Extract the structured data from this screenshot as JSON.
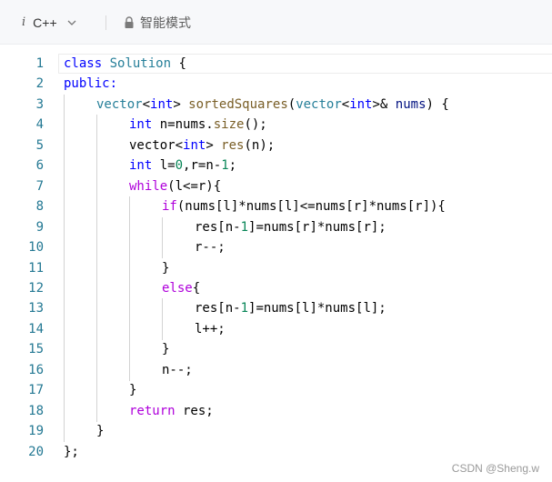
{
  "toolbar": {
    "info_glyph": "i",
    "language": "C++",
    "language_icon": "chevron-down-icon",
    "mode_icon": "lock-icon",
    "mode_label": "智能模式"
  },
  "editor": {
    "lines": [
      {
        "n": "1",
        "indent": 0,
        "tokens": [
          [
            "kw",
            "class"
          ],
          [
            "",
            " "
          ],
          [
            "typ",
            "Solution"
          ],
          [
            "",
            " {"
          ]
        ]
      },
      {
        "n": "2",
        "indent": 0,
        "tokens": [
          [
            "kw",
            "public:"
          ]
        ]
      },
      {
        "n": "3",
        "indent": 1,
        "tokens": [
          [
            "typ",
            "vector"
          ],
          [
            "",
            "<"
          ],
          [
            "kw",
            "int"
          ],
          [
            "",
            "> "
          ],
          [
            "fn",
            "sortedSquares"
          ],
          [
            "",
            "("
          ],
          [
            "typ",
            "vector"
          ],
          [
            "",
            "<"
          ],
          [
            "kw",
            "int"
          ],
          [
            "",
            "&gt;& "
          ],
          [
            "var",
            "nums"
          ],
          [
            "",
            ") {"
          ]
        ]
      },
      {
        "n": "4",
        "indent": 2,
        "tokens": [
          [
            "kw",
            "int"
          ],
          [
            "",
            ""
          ],
          [
            "",
            " n=nums."
          ],
          [
            "fn",
            "size"
          ],
          [
            "",
            "();"
          ]
        ]
      },
      {
        "n": "5",
        "indent": 2,
        "tokens": [
          [
            "",
            "vector<"
          ],
          [
            "kw",
            "int"
          ],
          [
            "",
            "> "
          ],
          [
            "fn",
            "res"
          ],
          [
            "",
            "(n);"
          ]
        ]
      },
      {
        "n": "6",
        "indent": 2,
        "tokens": [
          [
            "kw",
            "int"
          ],
          [
            "",
            " l="
          ],
          [
            "num",
            "0"
          ],
          [
            "",
            ",r=n-"
          ],
          [
            "num",
            "1"
          ],
          [
            "",
            ";"
          ]
        ]
      },
      {
        "n": "7",
        "indent": 2,
        "tokens": [
          [
            "ctl",
            "while"
          ],
          [
            "",
            "(l<=r){"
          ]
        ]
      },
      {
        "n": "8",
        "indent": 3,
        "tokens": [
          [
            "ctl",
            "if"
          ],
          [
            "",
            "(nums[l]*nums[l]<=nums[r]*nums[r]){"
          ]
        ]
      },
      {
        "n": "9",
        "indent": 4,
        "tokens": [
          [
            "",
            "res[n-"
          ],
          [
            "num",
            "1"
          ],
          [
            "",
            "]=nums[r]*nums[r];"
          ]
        ]
      },
      {
        "n": "10",
        "indent": 4,
        "tokens": [
          [
            "",
            "r--;"
          ]
        ]
      },
      {
        "n": "11",
        "indent": 3,
        "tokens": [
          [
            "",
            "}"
          ]
        ]
      },
      {
        "n": "12",
        "indent": 3,
        "tokens": [
          [
            "ctl",
            "else"
          ],
          [
            "",
            "{"
          ]
        ]
      },
      {
        "n": "13",
        "indent": 4,
        "tokens": [
          [
            "",
            "res[n-"
          ],
          [
            "num",
            "1"
          ],
          [
            "",
            "]=nums[l]*nums[l];"
          ]
        ]
      },
      {
        "n": "14",
        "indent": 4,
        "tokens": [
          [
            "",
            "l++;"
          ]
        ]
      },
      {
        "n": "15",
        "indent": 3,
        "tokens": [
          [
            "",
            "}"
          ]
        ]
      },
      {
        "n": "16",
        "indent": 3,
        "tokens": [
          [
            "",
            "n--;"
          ]
        ]
      },
      {
        "n": "17",
        "indent": 2,
        "tokens": [
          [
            "",
            "}"
          ]
        ]
      },
      {
        "n": "18",
        "indent": 2,
        "tokens": [
          [
            "ctl",
            "return"
          ],
          [
            "",
            " res;"
          ]
        ]
      },
      {
        "n": "19",
        "indent": 1,
        "tokens": [
          [
            "",
            "}"
          ]
        ]
      },
      {
        "n": "20",
        "indent": 0,
        "tokens": [
          [
            "",
            "};"
          ]
        ]
      }
    ]
  },
  "watermark": "CSDN @Sheng.w"
}
